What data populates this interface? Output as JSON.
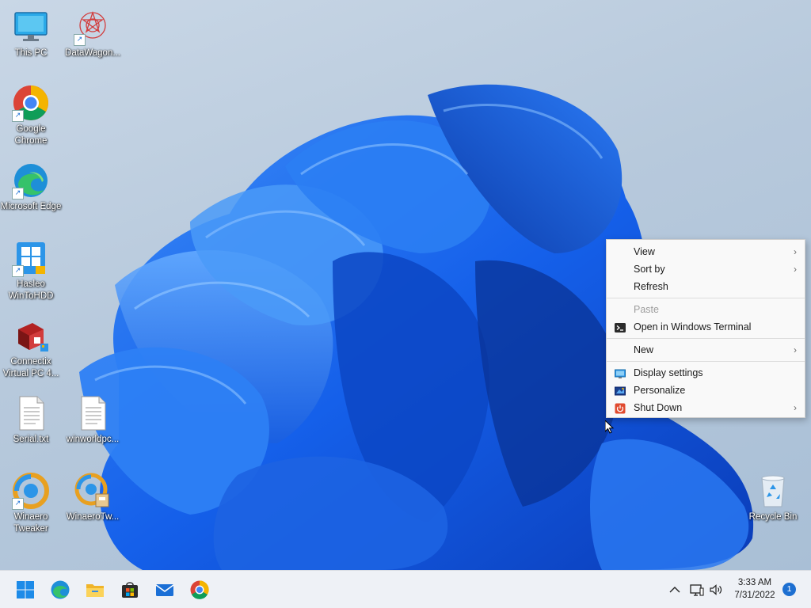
{
  "desktop": {
    "icons": [
      {
        "label": "This PC",
        "icon": "monitor-icon"
      },
      {
        "label": "DataWagon...",
        "icon": "datawagon-icon"
      },
      {
        "label": "Google Chrome",
        "icon": "chrome-icon"
      },
      {
        "label": "Microsoft Edge",
        "icon": "edge-icon"
      },
      {
        "label": "Hasleo WinToHDD",
        "icon": "wintohdd-icon"
      },
      {
        "label": "Connectix Virtual PC 4...",
        "icon": "connectix-icon"
      },
      {
        "label": "Serial.txt",
        "icon": "text-file-icon"
      },
      {
        "label": "winworldpc...",
        "icon": "text-file-icon"
      },
      {
        "label": "Winaero Tweaker",
        "icon": "winaero-icon"
      },
      {
        "label": "WinaeroTw...",
        "icon": "winaero-installer-icon"
      },
      {
        "label": "Recycle Bin",
        "icon": "recycle-bin-icon"
      }
    ]
  },
  "context_menu": {
    "view": "View",
    "sort_by": "Sort by",
    "refresh": "Refresh",
    "paste": "Paste",
    "open_terminal": "Open in Windows Terminal",
    "new": "New",
    "display_settings": "Display settings",
    "personalize": "Personalize",
    "shut_down": "Shut Down"
  },
  "taskbar": {
    "apps": [
      "start-icon",
      "edge-icon",
      "file-explorer-icon",
      "store-icon",
      "mail-icon",
      "chrome-icon"
    ],
    "clock": {
      "time": "3:33 AM",
      "date": "7/31/2022"
    },
    "notification_count": "1"
  },
  "colors": {
    "accent": "#1d6fd1",
    "wallpaper_blue": "#1565e8"
  }
}
